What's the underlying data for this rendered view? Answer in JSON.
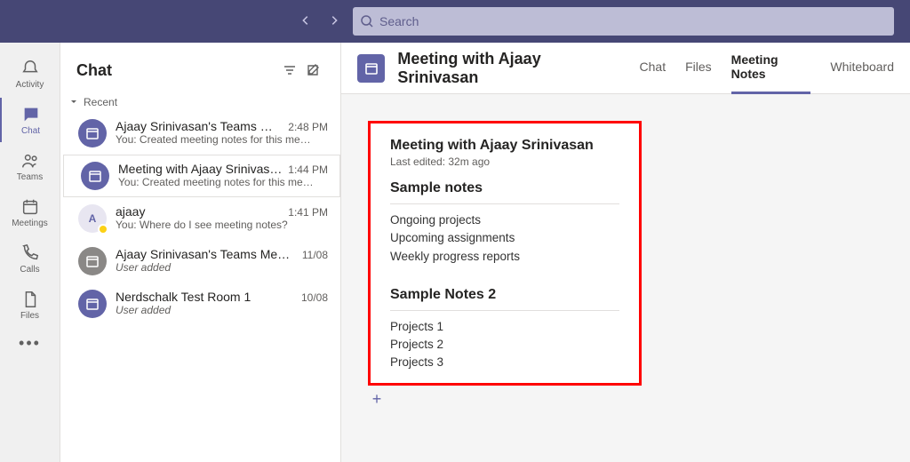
{
  "search": {
    "placeholder": "Search"
  },
  "rail": {
    "items": [
      {
        "label": "Activity"
      },
      {
        "label": "Chat"
      },
      {
        "label": "Teams"
      },
      {
        "label": "Meetings"
      },
      {
        "label": "Calls"
      },
      {
        "label": "Files"
      }
    ],
    "more": "…"
  },
  "chatList": {
    "header": "Chat",
    "recent_label": "Recent",
    "items": [
      {
        "title": "Ajaay Srinivasan's Teams Mee…",
        "time": "2:48 PM",
        "sub": "You: Created meeting notes for this me…",
        "italic": false
      },
      {
        "title": "Meeting with Ajaay Srinivasan",
        "time": "1:44 PM",
        "sub": "You: Created meeting notes for this me…",
        "italic": false
      },
      {
        "title": "ajaay",
        "time": "1:41 PM",
        "sub": "You: Where do I see meeting notes?",
        "italic": false
      },
      {
        "title": "Ajaay Srinivasan's Teams Meeting",
        "time": "11/08",
        "sub": "User added",
        "italic": true
      },
      {
        "title": "Nerdschalk Test Room 1",
        "time": "10/08",
        "sub": "User added",
        "italic": true
      }
    ]
  },
  "main": {
    "title": "Meeting with Ajaay Srinivasan",
    "tabs": [
      {
        "label": "Chat"
      },
      {
        "label": "Files"
      },
      {
        "label": "Meeting Notes"
      },
      {
        "label": "Whiteboard"
      }
    ]
  },
  "notes": {
    "title": "Meeting with Ajaay Srinivasan",
    "last_edited": "Last edited: 32m ago",
    "section1_title": "Sample notes",
    "section1_items": [
      "Ongoing projects",
      "Upcoming assignments",
      "Weekly progress reports"
    ],
    "section2_title": "Sample Notes 2",
    "section2_items": [
      "Projects 1",
      "Projects 2",
      "Projects 3"
    ]
  }
}
